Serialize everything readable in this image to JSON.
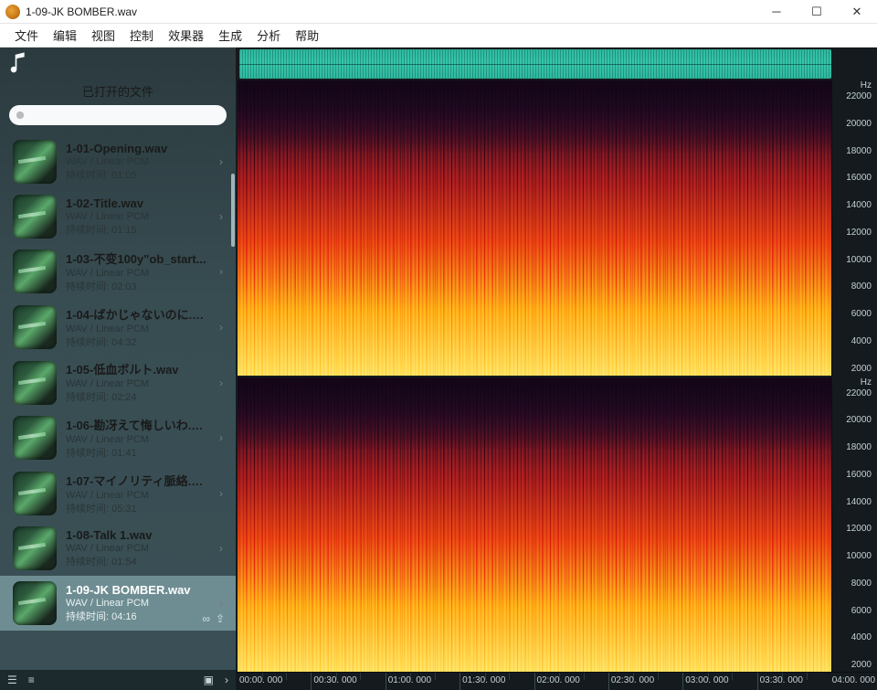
{
  "window": {
    "title": "1-09-JK BOMBER.wav"
  },
  "menu": {
    "file": "文件",
    "edit": "编辑",
    "view": "视图",
    "control": "控制",
    "effects": "效果器",
    "generate": "生成",
    "analyze": "分析",
    "help": "帮助"
  },
  "sidebar": {
    "header": "已打开的文件",
    "search_placeholder": "",
    "duration_prefix": "持续时间: ",
    "codec_label": "WAV / Linear PCM",
    "items": [
      {
        "title": "1-01-Opening.wav",
        "codec": "WAV / Linear PCM",
        "duration": "01:05"
      },
      {
        "title": "1-02-Title.wav",
        "codec": "WAV / Linear PCM",
        "duration": "01:15"
      },
      {
        "title": "1-03-不变100y\"ob_start...",
        "codec": "WAV / Linear PCM",
        "duration": "02:03"
      },
      {
        "title": "1-04-ばかじゃないのに.w...",
        "codec": "WAV / Linear PCM",
        "duration": "04:32"
      },
      {
        "title": "1-05-低血ボルト.wav",
        "codec": "WAV / Linear PCM",
        "duration": "02:24"
      },
      {
        "title": "1-06-勘冴えて悔しいわ.w...",
        "codec": "WAV / Linear PCM",
        "duration": "01:41"
      },
      {
        "title": "1-07-マイノリティ脈絡.w...",
        "codec": "WAV / Linear PCM",
        "duration": "05:31"
      },
      {
        "title": "1-08-Talk 1.wav",
        "codec": "WAV / Linear PCM",
        "duration": "01:54"
      },
      {
        "title": "1-09-JK BOMBER.wav",
        "codec": "WAV / Linear PCM",
        "duration": "04:16"
      }
    ],
    "active_index": 8
  },
  "freq": {
    "unit": "Hz",
    "ticks": [
      "22000",
      "20000",
      "18000",
      "16000",
      "14000",
      "12000",
      "10000",
      "8000",
      "6000",
      "4000",
      "2000"
    ]
  },
  "time": {
    "labels": [
      "00:00. 000",
      "00:30. 000",
      "01:00. 000",
      "01:30. 000",
      "02:00. 000",
      "02:30. 000",
      "03:00. 000",
      "03:30. 000"
    ],
    "end": "04:00. 000"
  }
}
